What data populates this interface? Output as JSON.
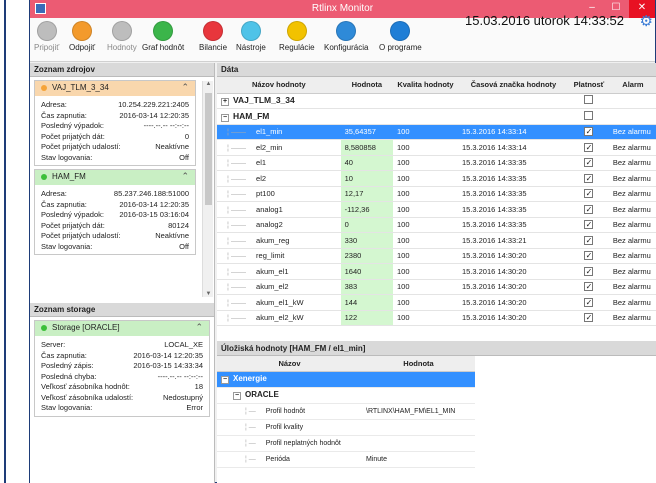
{
  "window": {
    "title": "Rtlinx Monitor",
    "datetime": "15.03.2016 utorok 14:33:52"
  },
  "toolbar": {
    "buttons": [
      {
        "label": "Pripojiť",
        "color": "#bdbdbd",
        "disabled": true
      },
      {
        "label": "Odpojiť",
        "color": "#f39a2c",
        "disabled": false
      },
      {
        "label": "Hodnoty",
        "color": "#bdbdbd",
        "disabled": true
      },
      {
        "label": "Graf hodnôt",
        "color": "#3bb54a",
        "disabled": false
      },
      {
        "label": "Bilancie",
        "color": "#e8363c",
        "disabled": false
      },
      {
        "label": "Nástroje",
        "color": "#4fc3e8",
        "disabled": false
      },
      {
        "label": "Regulácie",
        "color": "#f2c200",
        "disabled": false
      },
      {
        "label": "Konfigurácia",
        "color": "#2e8ad8",
        "disabled": false
      },
      {
        "label": "O programe",
        "color": "#1f7ed6",
        "disabled": false
      }
    ]
  },
  "left": {
    "sources_title": "Zoznam zdrojov",
    "sources": [
      {
        "name": "VAJ_TLM_3_34",
        "status": "orange",
        "fields": [
          {
            "k": "Adresa:",
            "v": "10.254.229.221:2405"
          },
          {
            "k": "Čas zapnutia:",
            "v": "2016-03-14  12:20:35"
          },
          {
            "k": "Posledný výpadok:",
            "v": "----.--.-- --:--:--"
          },
          {
            "k": "Počet prijatých dát:",
            "v": "0"
          },
          {
            "k": "Počet prijatých udalostí:",
            "v": "Neaktívne"
          },
          {
            "k": "Stav logovania:",
            "v": "Off"
          }
        ]
      },
      {
        "name": "HAM_FM",
        "status": "green",
        "fields": [
          {
            "k": "Adresa:",
            "v": "85.237.246.188:51000"
          },
          {
            "k": "Čas zapnutia:",
            "v": "2016-03-14  12:20:35"
          },
          {
            "k": "Posledný výpadok:",
            "v": "2016-03-15  03:16:04"
          },
          {
            "k": "Počet prijatých dát:",
            "v": "80124"
          },
          {
            "k": "Počet prijatých udalostí:",
            "v": "Neaktívne"
          },
          {
            "k": "Stav logovania:",
            "v": "Off"
          }
        ]
      }
    ],
    "storage_title": "Zoznam storage",
    "storage": {
      "name": "Storage [ORACLE]",
      "fields": [
        {
          "k": "Server:",
          "v": "LOCAL_XE"
        },
        {
          "k": "Čas zapnutia:",
          "v": "2016-03-14  12:20:35"
        },
        {
          "k": "Posledný zápis:",
          "v": "2016-03-15  14:33:34"
        },
        {
          "k": "Posledná chyba:",
          "v": "----.--.-- --:--:--"
        },
        {
          "k": "Veľkosť zásobníka hodnôt:",
          "v": "18"
        },
        {
          "k": "Veľkosť zásobníka udalostí:",
          "v": "Nedostupný"
        },
        {
          "k": "Stav logovania:",
          "v": "Error"
        }
      ]
    }
  },
  "data": {
    "title": "Dáta",
    "columns": [
      "Názov hodnoty",
      "Hodnota",
      "Kvalita hodnoty",
      "Časová značka hodnoty",
      "Platnosť",
      "Alarm"
    ],
    "groups": [
      {
        "name": "VAJ_TLM_3_34",
        "expanded": false,
        "rows": []
      },
      {
        "name": "HAM_FM",
        "expanded": true,
        "rows": [
          {
            "name": "el1_min",
            "value": "35,64357",
            "quality": "100",
            "ts": "15.3.2016 14:33:14",
            "valid": true,
            "alarm": "Bez alarmu",
            "selected": true
          },
          {
            "name": "el2_min",
            "value": "8,580858",
            "quality": "100",
            "ts": "15.3.2016 14:33:14",
            "valid": true,
            "alarm": "Bez alarmu"
          },
          {
            "name": "el1",
            "value": "40",
            "quality": "100",
            "ts": "15.3.2016 14:33:35",
            "valid": true,
            "alarm": "Bez alarmu"
          },
          {
            "name": "el2",
            "value": "10",
            "quality": "100",
            "ts": "15.3.2016 14:33:35",
            "valid": true,
            "alarm": "Bez alarmu"
          },
          {
            "name": "pt100",
            "value": "12,17",
            "quality": "100",
            "ts": "15.3.2016 14:33:35",
            "valid": true,
            "alarm": "Bez alarmu"
          },
          {
            "name": "analog1",
            "value": "-112,36",
            "quality": "100",
            "ts": "15.3.2016 14:33:35",
            "valid": true,
            "alarm": "Bez alarmu"
          },
          {
            "name": "analog2",
            "value": "0",
            "quality": "100",
            "ts": "15.3.2016 14:33:35",
            "valid": true,
            "alarm": "Bez alarmu"
          },
          {
            "name": "akum_reg",
            "value": "330",
            "quality": "100",
            "ts": "15.3.2016 14:33:21",
            "valid": true,
            "alarm": "Bez alarmu"
          },
          {
            "name": "reg_limit",
            "value": "2380",
            "quality": "100",
            "ts": "15.3.2016 14:30:20",
            "valid": true,
            "alarm": "Bez alarmu"
          },
          {
            "name": "akum_el1",
            "value": "1640",
            "quality": "100",
            "ts": "15.3.2016 14:30:20",
            "valid": true,
            "alarm": "Bez alarmu"
          },
          {
            "name": "akum_el2",
            "value": "383",
            "quality": "100",
            "ts": "15.3.2016 14:30:20",
            "valid": true,
            "alarm": "Bez alarmu"
          },
          {
            "name": "akum_el1_kW",
            "value": "144",
            "quality": "100",
            "ts": "15.3.2016 14:30:20",
            "valid": true,
            "alarm": "Bez alarmu"
          },
          {
            "name": "akum_el2_kW",
            "value": "122",
            "quality": "100",
            "ts": "15.3.2016 14:30:20",
            "valid": true,
            "alarm": "Bez alarmu"
          }
        ]
      }
    ]
  },
  "storage_values": {
    "title": "Úložiská hodnoty [HAM_FM / el1_min]",
    "columns": [
      "Názov",
      "Hodnota"
    ],
    "root": "Xenergie",
    "db": "ORACLE",
    "rows": [
      {
        "name": "Profil hodnôt",
        "value": "\\RTLINX\\HAM_FM\\EL1_MIN"
      },
      {
        "name": "Profil kvality",
        "value": ""
      },
      {
        "name": "Profil neplatných hodnôt",
        "value": ""
      },
      {
        "name": "Perióda",
        "value": "Minute"
      }
    ]
  }
}
